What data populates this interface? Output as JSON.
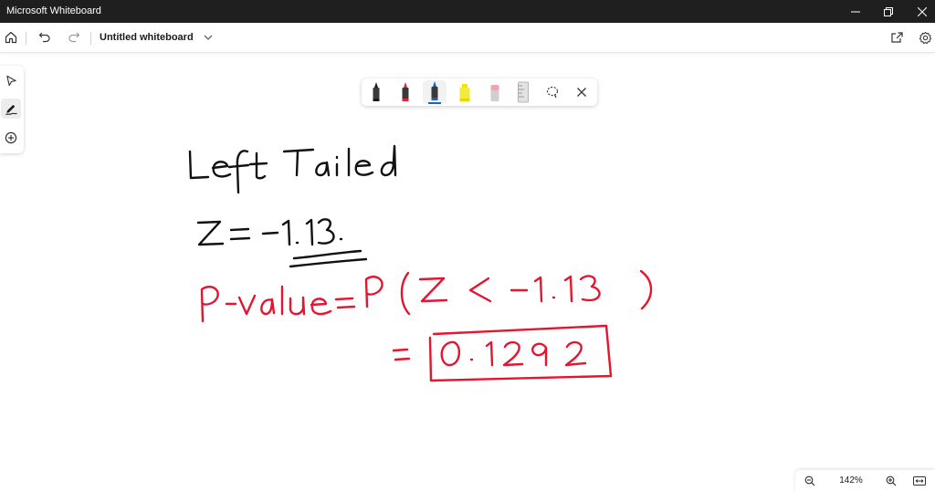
{
  "window": {
    "title": "Microsoft Whiteboard"
  },
  "commandbar": {
    "doc_title": "Untitled whiteboard",
    "icons": [
      "home-icon",
      "undo-icon",
      "redo-icon",
      "chevron-down-icon",
      "share-icon",
      "settings-icon"
    ]
  },
  "left_toolbar": {
    "tools": [
      "select-icon",
      "inking-icon",
      "add-icon"
    ],
    "active": "inking-icon"
  },
  "ink_toolbar": {
    "pens": [
      {
        "name": "black-pen",
        "color": "#1a1a1a"
      },
      {
        "name": "red-pen",
        "color": "#e0243a"
      },
      {
        "name": "blue-pen",
        "color": "#1565c0"
      },
      {
        "name": "yellow-highlighter",
        "color": "#f5e300"
      }
    ],
    "active_pen": "blue-pen",
    "extras": [
      "eraser-icon",
      "ruler-icon",
      "lasso-icon",
      "close-icon"
    ]
  },
  "ink": {
    "black_color": "#111111",
    "red_color": "#e3152f"
  },
  "zoom": {
    "level": "142%"
  }
}
